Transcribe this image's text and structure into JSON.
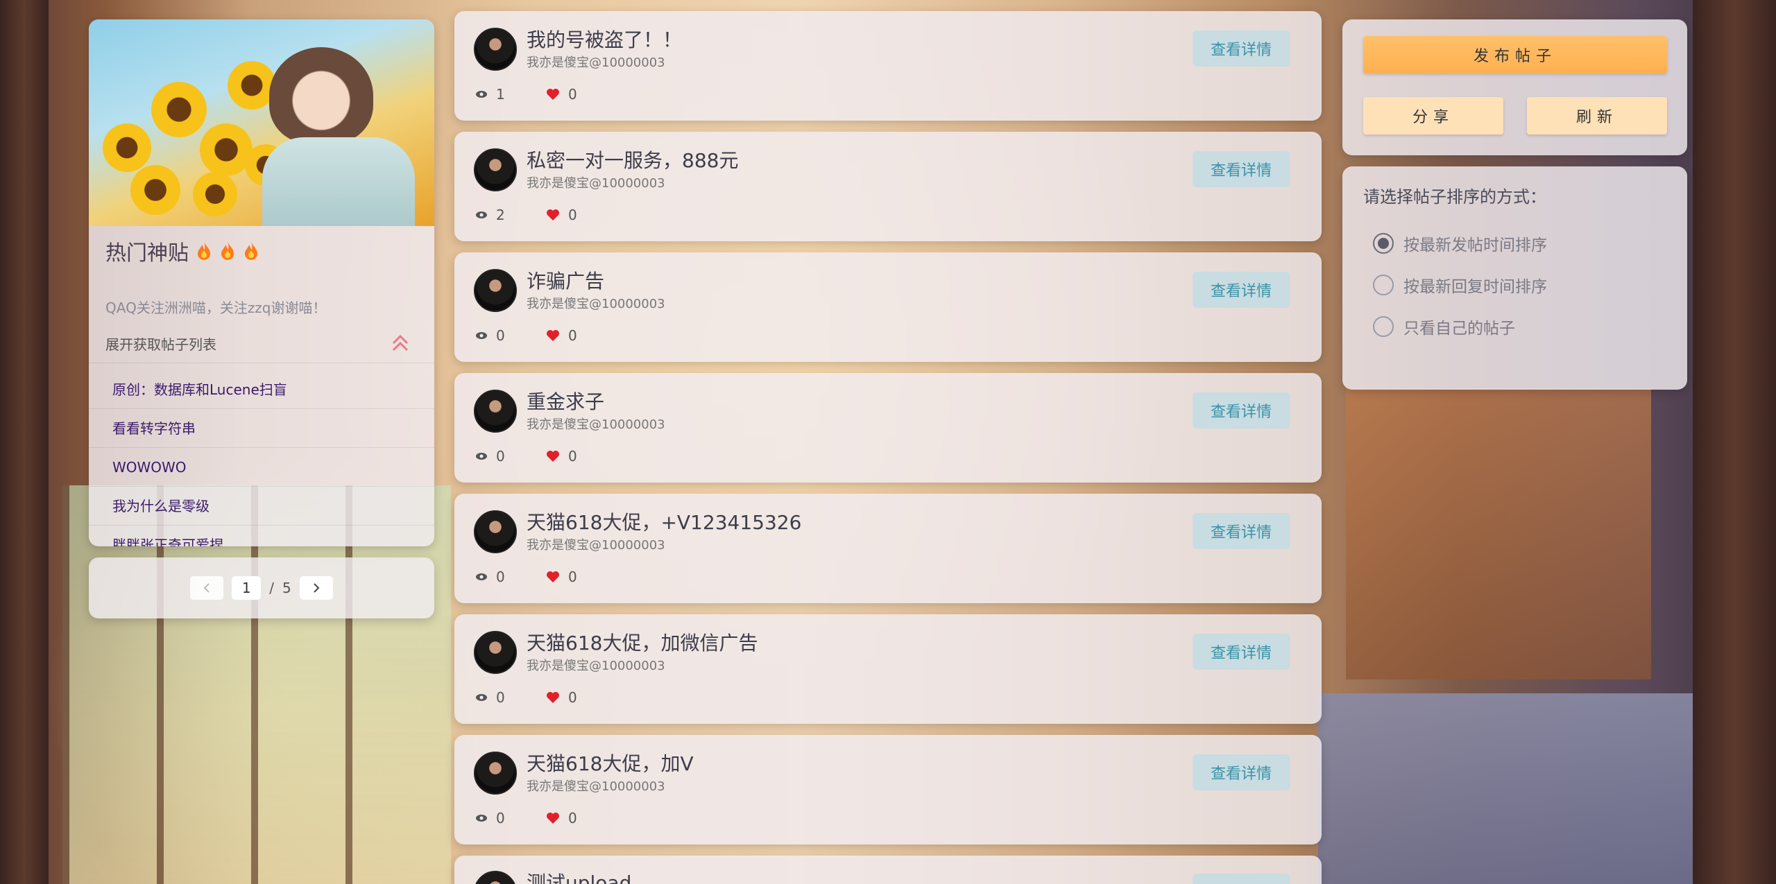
{
  "hot": {
    "title": "热门神贴",
    "subtitle": "QAQ关注洲洲喵，关注zzq谢谢喵！",
    "expand_label": "展开获取帖子列表",
    "items": [
      "原创：数据库和Lucene扫盲",
      "看看转字符串",
      "WOWOWO",
      "我为什么是零级",
      "胖胖张正奇可爱捏"
    ]
  },
  "pagination": {
    "current": "1",
    "separator": "/",
    "total": "5"
  },
  "detail_label": "查看详情",
  "posts": [
    {
      "title": "我的号被盗了！！",
      "author": "我亦是傻宝@10000003",
      "views": "1",
      "likes": "0"
    },
    {
      "title": "私密一对一服务，888元",
      "author": "我亦是傻宝@10000003",
      "views": "2",
      "likes": "0"
    },
    {
      "title": "诈骗广告",
      "author": "我亦是傻宝@10000003",
      "views": "0",
      "likes": "0"
    },
    {
      "title": "重金求子",
      "author": "我亦是傻宝@10000003",
      "views": "0",
      "likes": "0"
    },
    {
      "title": "天猫618大促，+V123415326",
      "author": "我亦是傻宝@10000003",
      "views": "0",
      "likes": "0"
    },
    {
      "title": "天猫618大促，加微信广告",
      "author": "我亦是傻宝@10000003",
      "views": "0",
      "likes": "0"
    },
    {
      "title": "天猫618大促，加V",
      "author": "我亦是傻宝@10000003",
      "views": "0",
      "likes": "0"
    },
    {
      "title": "测试upload",
      "author": "",
      "views": "",
      "likes": ""
    }
  ],
  "actions": {
    "publish": "发布帖子",
    "share": "分享",
    "refresh": "刷新"
  },
  "sort": {
    "title": "请选择帖子排序的方式：",
    "options": [
      "按最新发帖时间排序",
      "按最新回复时间排序",
      "只看自己的帖子"
    ],
    "selected": "按最新发帖时间排序"
  },
  "colors": {
    "accent_publish": "#ffb050",
    "accent_secondary": "#ffe1b8",
    "detail_text": "#3a93a8",
    "like_heart": "#e0202a",
    "hot_item_text": "#3a1a6a"
  }
}
